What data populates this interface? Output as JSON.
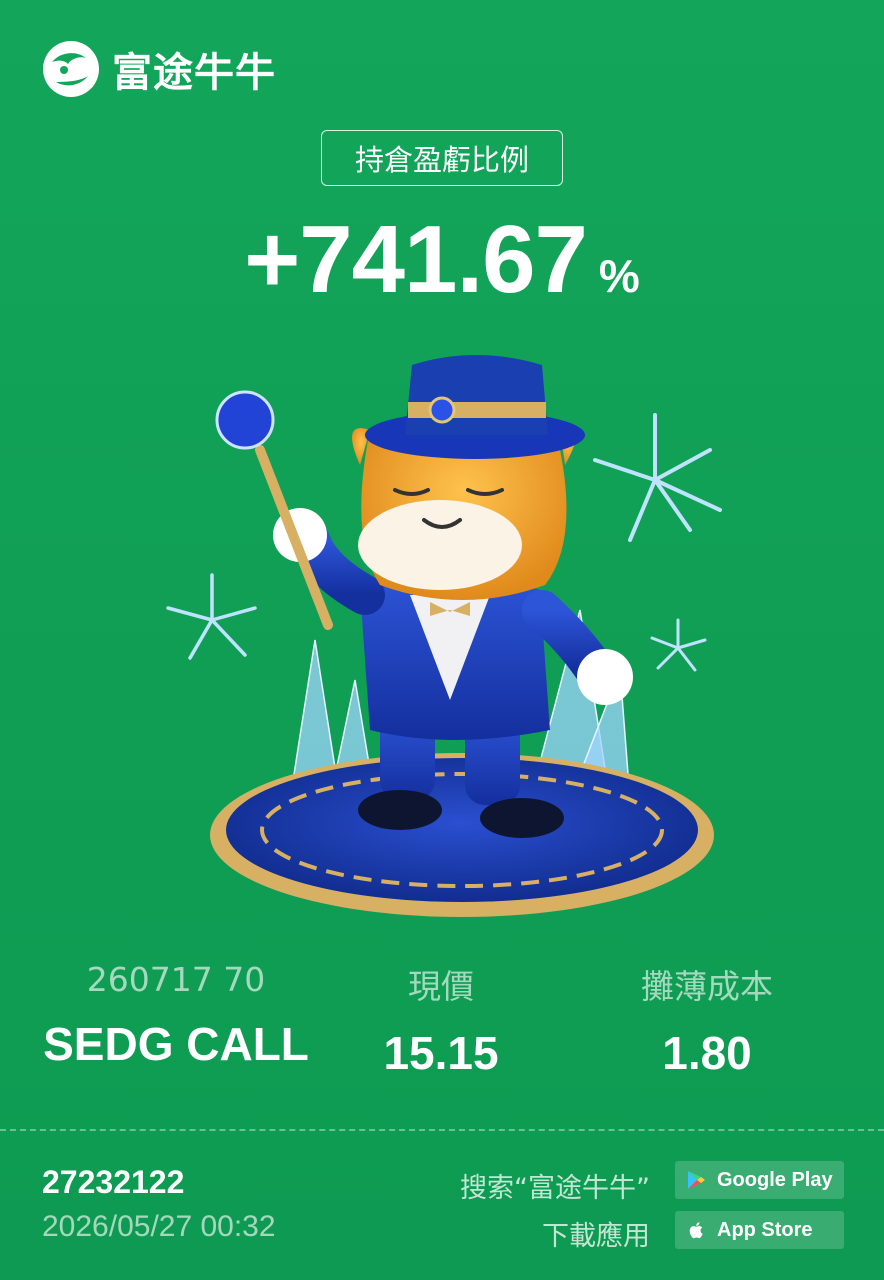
{
  "brand": {
    "name": "富途牛牛"
  },
  "header": {
    "metric_label": "持倉盈虧比例"
  },
  "result": {
    "value": "+741.67",
    "unit": "%"
  },
  "stats": {
    "contract": {
      "label": "260717 70",
      "value": "SEDG CALL"
    },
    "price": {
      "label": "現價",
      "value": "15.15"
    },
    "cost": {
      "label": "攤薄成本",
      "value": "1.80"
    }
  },
  "footer": {
    "user_id": "27232122",
    "timestamp": "2026/05/27 00:32",
    "search_hint": "搜索“富途牛牛”",
    "download_hint": "下載應用",
    "google_play": "Google Play",
    "app_store": "App Store"
  },
  "colors": {
    "background": "#13a65a",
    "accent_blue": "#1a3fb0",
    "mascot_orange": "#f2a531",
    "gold": "#d9b25a"
  },
  "icons": [
    "futu-logo-icon",
    "google-play-icon",
    "apple-icon"
  ]
}
